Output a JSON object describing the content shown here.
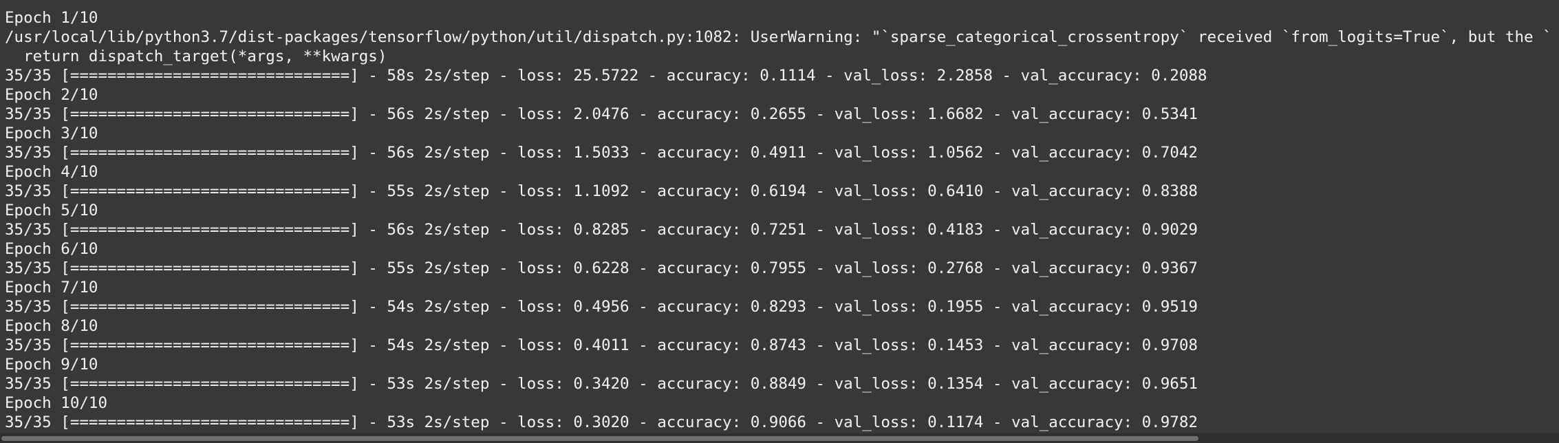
{
  "terminal": {
    "lines": [
      "Epoch 1/10",
      "/usr/local/lib/python3.7/dist-packages/tensorflow/python/util/dispatch.py:1082: UserWarning: \"`sparse_categorical_crossentropy` received `from_logits=True`, but the `output` argument was produced by a sigmoid or softmax activation and thus does not represent logits. Was this intended?\"",
      "  return dispatch_target(*args, **kwargs)",
      "35/35 [==============================] - 58s 2s/step - loss: 25.5722 - accuracy: 0.1114 - val_loss: 2.2858 - val_accuracy: 0.2088",
      "Epoch 2/10",
      "35/35 [==============================] - 56s 2s/step - loss: 2.0476 - accuracy: 0.2655 - val_loss: 1.6682 - val_accuracy: 0.5341",
      "Epoch 3/10",
      "35/35 [==============================] - 56s 2s/step - loss: 1.5033 - accuracy: 0.4911 - val_loss: 1.0562 - val_accuracy: 0.7042",
      "Epoch 4/10",
      "35/35 [==============================] - 55s 2s/step - loss: 1.1092 - accuracy: 0.6194 - val_loss: 0.6410 - val_accuracy: 0.8388",
      "Epoch 5/10",
      "35/35 [==============================] - 56s 2s/step - loss: 0.8285 - accuracy: 0.7251 - val_loss: 0.4183 - val_accuracy: 0.9029",
      "Epoch 6/10",
      "35/35 [==============================] - 55s 2s/step - loss: 0.6228 - accuracy: 0.7955 - val_loss: 0.2768 - val_accuracy: 0.9367",
      "Epoch 7/10",
      "35/35 [==============================] - 54s 2s/step - loss: 0.4956 - accuracy: 0.8293 - val_loss: 0.1955 - val_accuracy: 0.9519",
      "Epoch 8/10",
      "35/35 [==============================] - 54s 2s/step - loss: 0.4011 - accuracy: 0.8743 - val_loss: 0.1453 - val_accuracy: 0.9708",
      "Epoch 9/10",
      "35/35 [==============================] - 53s 2s/step - loss: 0.3420 - accuracy: 0.8849 - val_loss: 0.1354 - val_accuracy: 0.9651",
      "Epoch 10/10",
      "35/35 [==============================] - 53s 2s/step - loss: 0.3020 - accuracy: 0.9066 - val_loss: 0.1174 - val_accuracy: 0.9782"
    ]
  }
}
